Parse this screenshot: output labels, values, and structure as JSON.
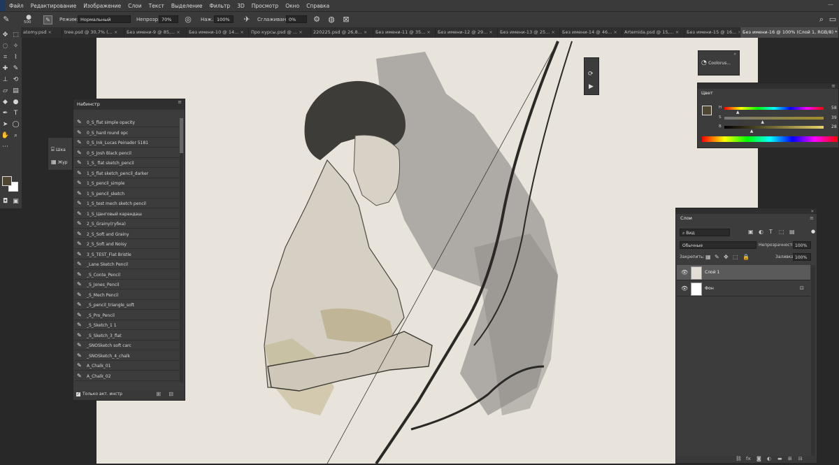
{
  "menu": [
    "Файл",
    "Редактирование",
    "Изображение",
    "Слои",
    "Текст",
    "Выделение",
    "Фильтр",
    "3D",
    "Просмотр",
    "Окно",
    "Справка"
  ],
  "options": {
    "brush_size": "500",
    "mode_label": "Режим:",
    "mode_value": "Нормальный",
    "opacity_label": "Непрозр.:",
    "opacity_value": "70%",
    "pressure_label": "Наж.:",
    "pressure_value": "100%",
    "smoothing_label": "Сглаживание:",
    "smoothing_value": "0%"
  },
  "tabs": [
    "atomy.psd",
    "tree.psd @ 30,7% (...",
    "Без имени-9 @ 85,...",
    "Без имени-10 @ 14...",
    "Про курсы.psd @ ...",
    "220225.psd @ 26,8...",
    "Без имени-11 @ 35...",
    "Без имени-12 @ 29...",
    "Без имени-13 @ 25...",
    "Без имени-14 @ 46...",
    "Artemida.psd @ 15,...",
    "Без имени-15 @ 16...",
    "Без имени-16 @ 100% (Слой 1, RGB/8) *"
  ],
  "colors": {
    "foreground": "#4e4630",
    "background": "#ffffff",
    "paper": "#e8e3db",
    "panel": "#3c3c3c"
  },
  "brushes_panel": {
    "title": "Набинстр",
    "items": [
      "0_S_flat simple opacity",
      "0_S_hard round opc",
      "0_S_Ink_Lucas Peinador 5181",
      "0_S_Josh Black pencil",
      "1_S_ flat sketch_pencil",
      "1_S_flat sketch_pencil_darker",
      "1_S_pencil_simple",
      "1_S_pencil_sketch",
      "1_S_test mech sketch pencil",
      "1_S_Цанговый карандаш",
      "2_S_Grainy(губка)",
      "2_S_Soft and Grainy",
      "2_S_Soft and Noisy",
      "3_S_TEST_Flat Bristle",
      "_Lane Sketch Pencil",
      "_S_Conte_Pencil",
      "_S_Jones_Pencil",
      "_S_Mech Pencil",
      "_S_pencil_triangle_soft",
      "_S_Pro_Pencil",
      "_S_Sketch_1 1",
      "_S_Sketch_3_flat",
      "_SNOSketch soft carc",
      "_SNOSketch_4_chalk",
      "A_Chalk_01",
      "A_Chalk_02"
    ],
    "footer_checkbox": "Только акт. инстр"
  },
  "mini_panel": {
    "item1": "Шка",
    "item2": "Жур"
  },
  "coolorus": {
    "label": "Coolorus..."
  },
  "color_panel": {
    "title": "Цвет",
    "rows": [
      {
        "label": "H",
        "value": "58",
        "pos": 0.14
      },
      {
        "label": "S",
        "value": "39",
        "pos": 0.39
      },
      {
        "label": "B",
        "value": "28",
        "pos": 0.28
      }
    ]
  },
  "layers_panel": {
    "title": "Слои",
    "search": "Вид",
    "blend": "Обычные",
    "opacity_label": "Непрозрачность:",
    "opacity_value": "100%",
    "lock_label": "Закрепить:",
    "fill_label": "Заливка:",
    "fill_value": "100%",
    "layers": [
      {
        "name": "Слой 1",
        "selected": true
      },
      {
        "name": "Фон",
        "selected": false
      }
    ]
  }
}
